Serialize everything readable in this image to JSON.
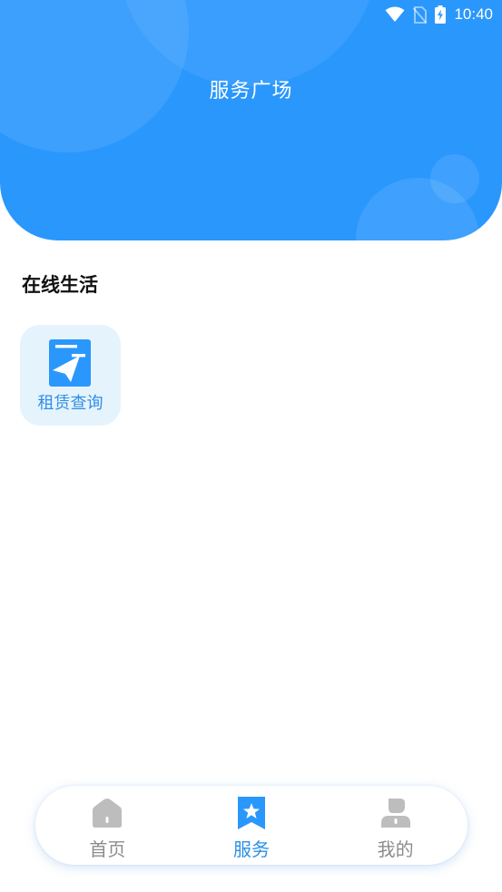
{
  "status_bar": {
    "time": "10:40",
    "icons": [
      "wifi-icon",
      "no-sim-icon",
      "battery-charging-icon"
    ]
  },
  "header": {
    "title": "服务广场",
    "background_color": "#2a97fd"
  },
  "section": {
    "title": "在线生活"
  },
  "services": [
    {
      "label": "租赁查询",
      "icon": "paper-plane-document-icon"
    }
  ],
  "tabbar": {
    "tabs": [
      {
        "label": "首页",
        "icon": "home-icon",
        "active": false
      },
      {
        "label": "服务",
        "icon": "bookmark-star-icon",
        "active": true
      },
      {
        "label": "我的",
        "icon": "user-icon",
        "active": false
      }
    ],
    "active_color": "#2a8fe8",
    "inactive_color": "#8c8c8c"
  }
}
